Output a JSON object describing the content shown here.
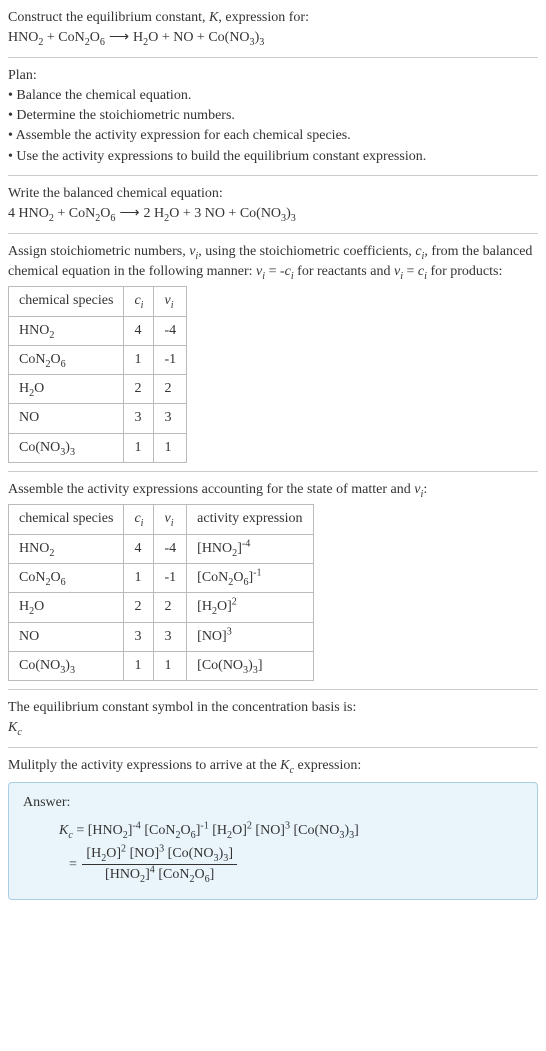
{
  "sec1": {
    "line1": "Construct the equilibrium constant, ",
    "k": "K",
    "line1b": ", expression for:"
  },
  "sec2": {
    "heading": "Plan:",
    "b1": "• Balance the chemical equation.",
    "b2": "• Determine the stoichiometric numbers.",
    "b3": "• Assemble the activity expression for each chemical species.",
    "b4": "• Use the activity expressions to build the equilibrium constant expression."
  },
  "sec3": {
    "line1": "Write the balanced chemical equation:"
  },
  "sec4": {
    "t1h": {
      "c1": "chemical species",
      "c2": "cᵢ",
      "c3": "νᵢ"
    },
    "r1": {
      "c1": "HNO₂",
      "c2": "4",
      "c3": "-4"
    },
    "r2": {
      "c1": "CoN₂O₆",
      "c2": "1",
      "c3": "-1"
    },
    "r3": {
      "c1": "H₂O",
      "c2": "2",
      "c3": "2"
    },
    "r4": {
      "c1": "NO",
      "c2": "3",
      "c3": "3"
    },
    "r5": {
      "c1": "Co(NO₃)₃",
      "c2": "1",
      "c3": "1"
    }
  },
  "sec5": {
    "heading_a": "Assemble the activity expressions accounting for the state of matter and ",
    "heading_b": ":",
    "t2h": {
      "c1": "chemical species",
      "c2": "cᵢ",
      "c3": "νᵢ",
      "c4": "activity expression"
    },
    "r1": {
      "c1": "HNO₂",
      "c2": "4",
      "c3": "-4"
    },
    "r2": {
      "c1": "CoN₂O₆",
      "c2": "1",
      "c3": "-1"
    },
    "r3": {
      "c1": "H₂O",
      "c2": "2",
      "c3": "2"
    },
    "r4": {
      "c1": "NO",
      "c2": "3",
      "c3": "3"
    },
    "r5": {
      "c1": "Co(NO₃)₃",
      "c2": "1",
      "c3": "1"
    }
  },
  "sec6": {
    "line1": "The equilibrium constant symbol in the concentration basis is:"
  },
  "sec7": {
    "line1_a": "Mulitply the activity expressions to arrive at the ",
    "line1_b": " expression:"
  },
  "answer": {
    "label": "Answer:"
  },
  "chart_data": {
    "type": "table",
    "reaction_unbalanced": "HNO2 + CoN2O6 -> H2O + NO + Co(NO3)3",
    "reaction_balanced": "4 HNO2 + CoN2O6 -> 2 H2O + 3 NO + Co(NO3)3",
    "stoichiometric_table": {
      "columns": [
        "chemical species",
        "c_i",
        "v_i"
      ],
      "rows": [
        [
          "HNO2",
          4,
          -4
        ],
        [
          "CoN2O6",
          1,
          -1
        ],
        [
          "H2O",
          2,
          2
        ],
        [
          "NO",
          3,
          3
        ],
        [
          "Co(NO3)3",
          1,
          1
        ]
      ]
    },
    "activity_table": {
      "columns": [
        "chemical species",
        "c_i",
        "v_i",
        "activity expression"
      ],
      "rows": [
        [
          "HNO2",
          4,
          -4,
          "[HNO2]^-4"
        ],
        [
          "CoN2O6",
          1,
          -1,
          "[CoN2O6]^-1"
        ],
        [
          "H2O",
          2,
          2,
          "[H2O]^2"
        ],
        [
          "NO",
          3,
          3,
          "[NO]^3"
        ],
        [
          "Co(NO3)3",
          1,
          1,
          "[Co(NO3)3]"
        ]
      ]
    },
    "Kc_product_form": "Kc = [HNO2]^-4 [CoN2O6]^-1 [H2O]^2 [NO]^3 [Co(NO3)3]",
    "Kc_fraction_form": "Kc = ([H2O]^2 [NO]^3 [Co(NO3)3]) / ([HNO2]^4 [CoN2O6])"
  }
}
